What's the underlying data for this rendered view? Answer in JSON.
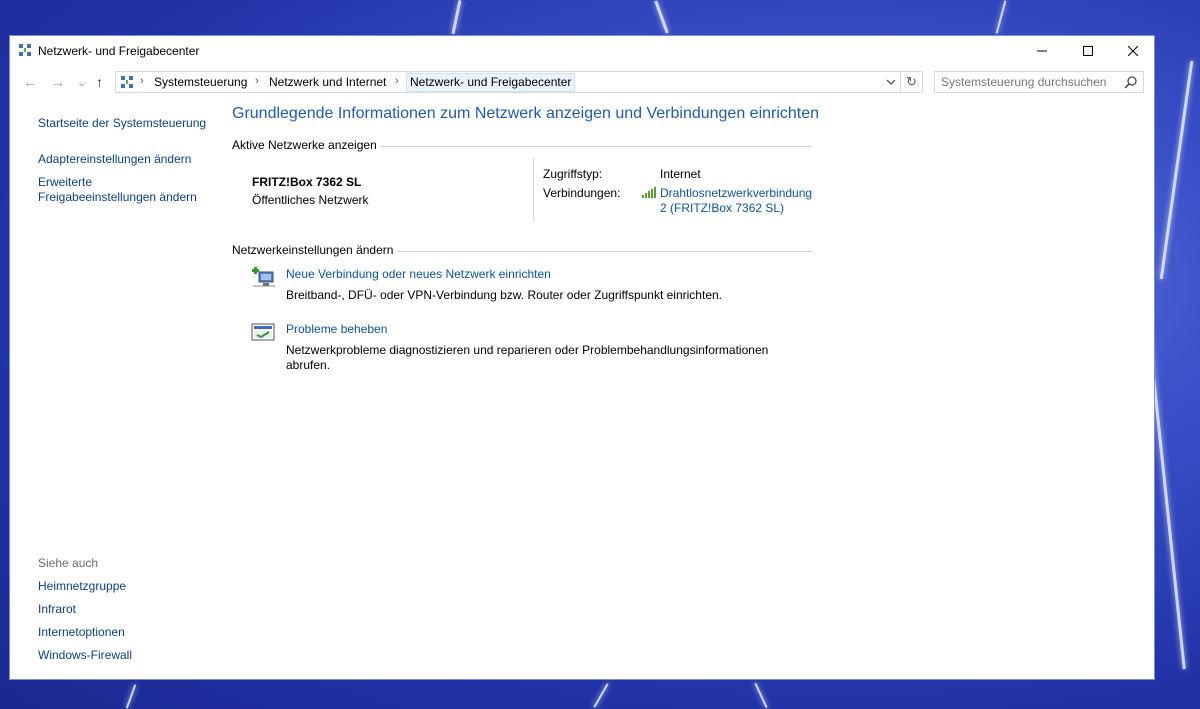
{
  "window": {
    "title": "Netzwerk- und Freigabecenter"
  },
  "controls": {
    "minimize": "—",
    "maximize": "☐",
    "close": "✕"
  },
  "nav": {
    "back": "←",
    "forward": "→",
    "recent": "⌄",
    "up": "↑"
  },
  "breadcrumb": {
    "items": [
      "Systemsteuerung",
      "Netzwerk und Internet",
      "Netzwerk- und Freigabecenter"
    ],
    "separator": "›"
  },
  "search": {
    "placeholder": "Systemsteuerung durchsuchen"
  },
  "sidebar": {
    "items": [
      {
        "label": "Startseite der Systemsteuerung"
      },
      {
        "label": "Adaptereinstellungen ändern"
      },
      {
        "label_line1": "Erweiterte",
        "label_line2": "Freigabeeinstellungen ändern"
      }
    ],
    "see_also_title": "Siehe auch",
    "see_also": [
      "Heimnetzgruppe",
      "Infrarot",
      "Internetoptionen",
      "Windows-Firewall"
    ]
  },
  "main": {
    "heading": "Grundlegende Informationen zum Netzwerk anzeigen und Verbindungen einrichten",
    "active_networks_title": "Aktive Netzwerke anzeigen",
    "network": {
      "name": "FRITZ!Box 7362 SL",
      "type": "Öffentliches Netzwerk",
      "access_label": "Zugriffstyp:",
      "access_value": "Internet",
      "connections_label": "Verbindungen:",
      "connection_line1": "Drahtlosnetzwerkverbindung",
      "connection_line2": "2 (FRITZ!Box 7362 SL)"
    },
    "change_settings_title": "Netzwerkeinstellungen ändern",
    "tasks": [
      {
        "title": "Neue Verbindung oder neues Netzwerk einrichten",
        "description": "Breitband-, DFÜ- oder VPN-Verbindung bzw. Router oder Zugriffspunkt einrichten."
      },
      {
        "title": "Probleme beheben",
        "description_line1": "Netzwerkprobleme diagnostizieren und reparieren oder Problembehandlungsinformationen",
        "description_line2": "abrufen."
      }
    ]
  },
  "colors": {
    "link": "#0b52a9",
    "heading": "#1e5ab4",
    "desktop": "#2233a8"
  }
}
